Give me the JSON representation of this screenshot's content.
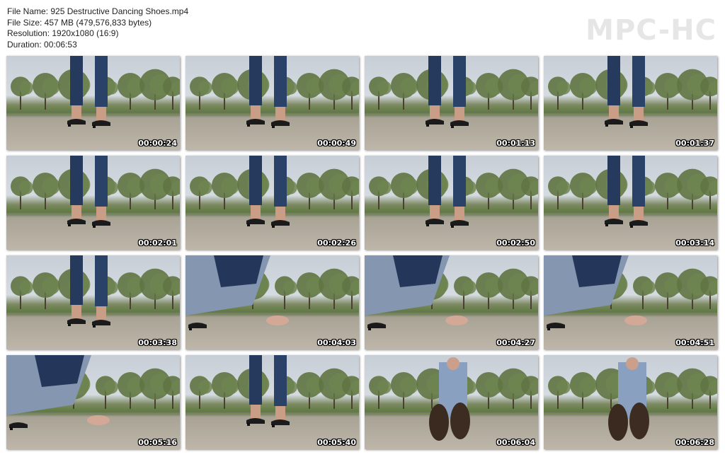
{
  "file_info": {
    "name_line": "File Name: 925 Destructive Dancing Shoes.mp4",
    "size_line": "File Size: 457 MB (479,576,833 bytes)",
    "resolution_line": "Resolution: 1920x1080 (16:9)",
    "duration_line": "Duration: 00:06:53"
  },
  "logo": "MPC-HC",
  "thumbnails": [
    {
      "time": "00:00:24",
      "scene": "standing"
    },
    {
      "time": "00:00:49",
      "scene": "standing"
    },
    {
      "time": "00:01:13",
      "scene": "standing"
    },
    {
      "time": "00:01:37",
      "scene": "standing"
    },
    {
      "time": "00:02:01",
      "scene": "standing"
    },
    {
      "time": "00:02:26",
      "scene": "standing"
    },
    {
      "time": "00:02:50",
      "scene": "stepping"
    },
    {
      "time": "00:03:14",
      "scene": "stepping"
    },
    {
      "time": "00:03:38",
      "scene": "stepping"
    },
    {
      "time": "00:04:03",
      "scene": "crouching"
    },
    {
      "time": "00:04:27",
      "scene": "crouching"
    },
    {
      "time": "00:04:51",
      "scene": "crouching"
    },
    {
      "time": "00:05:16",
      "scene": "crouching"
    },
    {
      "time": "00:05:40",
      "scene": "stepping"
    },
    {
      "time": "00:06:04",
      "scene": "sitting"
    },
    {
      "time": "00:06:28",
      "scene": "sitting"
    }
  ]
}
